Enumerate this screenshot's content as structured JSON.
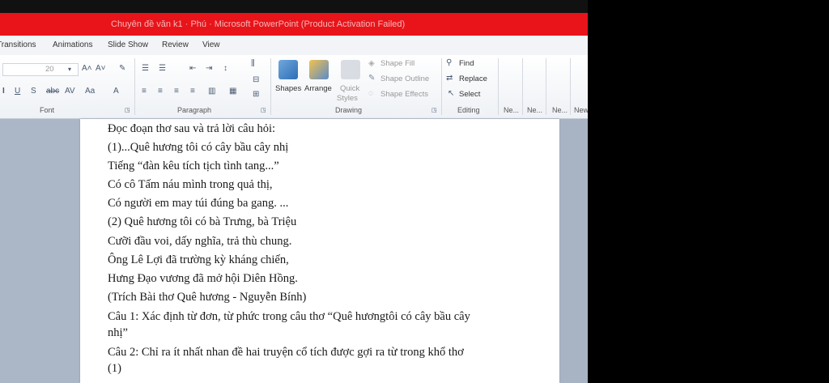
{
  "window": {
    "title": "Chuyên đề văn k1 · Phú · Microsoft PowerPoint (Product Activation Failed)"
  },
  "menu": [
    "Transitions",
    "Animations",
    "Slide Show",
    "Review",
    "View"
  ],
  "ribbon": {
    "font_size": "20",
    "groups": {
      "font": "Font",
      "paragraph": "Paragraph",
      "drawing": "Drawing",
      "editing": "Editing",
      "extra": [
        "Ne...",
        "Ne...",
        "Ne...",
        "New"
      ]
    },
    "drawing": {
      "shapes": "Shapes",
      "arrange": "Arrange",
      "quick_styles_1": "Quick",
      "quick_styles_2": "Styles",
      "shape_fill": "Shape Fill",
      "shape_outline": "Shape Outline",
      "shape_effects": "Shape Effects"
    },
    "editing": {
      "find": "Find",
      "replace": "Replace",
      "select": "Select"
    }
  },
  "document": {
    "lines": [
      "Đọc đoạn thơ sau và trả lời câu hỏi:",
      " (1)...Quê hương tôi có cây bầu cây nhị",
      "Tiếng “đàn kêu tích tịch tình tang...”",
      " Có cô Tấm náu mình trong quả thị,",
      " Có người em may túi đúng ba gang. ...",
      "(2) Quê hương tôi có bà Trưng, bà Triệu",
      "Cưỡi đầu voi, dấy nghĩa, trả thù chung.",
      "Ông Lê Lợi đã trường kỳ kháng chiến,",
      " Hưng Đạo vương đã mở hội Diên Hồng.",
      " (Trích Bài thơ Quê hương - Nguyễn Bính)",
      "Câu 1: Xác định từ đơn, từ phức trong câu thơ “Quê hươngtôi có cây bầu cây",
      "nhị”",
      "Câu 2: Chỉ ra ít nhất nhan đề hai truyện cổ tích được gợi ra từ trong khổ thơ",
      "(1)"
    ]
  },
  "colors": {
    "title_bar": "#e8141a",
    "ribbon_bg": "#f2f4f7",
    "workspace": "#abb6c6"
  }
}
